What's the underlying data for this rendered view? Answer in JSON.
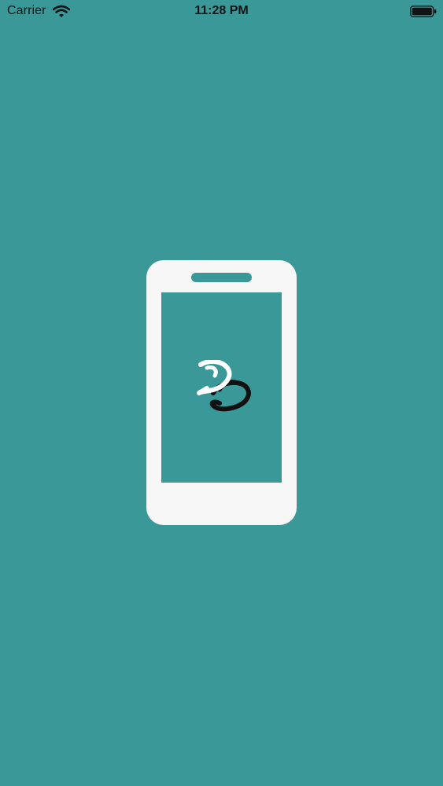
{
  "status_bar": {
    "carrier": "Carrier",
    "time": "11:28 PM",
    "wifi_icon": "wifi-icon",
    "battery_icon": "battery-icon"
  },
  "splash": {
    "background_color": "#3a9898",
    "illustration_color": "#f7f7f7",
    "illustration_icon": "smartphone-icon",
    "logo_icon": "app-logo-icon"
  }
}
